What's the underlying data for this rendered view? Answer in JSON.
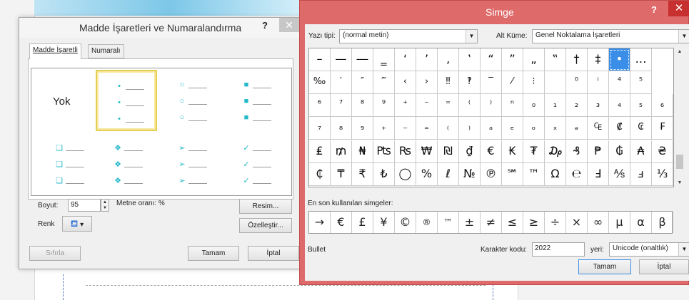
{
  "bullets_dialog": {
    "title": "Madde İşaretleri ve Numaralandırma",
    "help": "?",
    "close": "✕",
    "tabs": [
      "Madde İşaretli",
      "Numaralı"
    ],
    "none_label": "Yok",
    "rows": [
      [
        "•",
        "○",
        "■"
      ],
      [
        "❑",
        "❖",
        "➢",
        "✓"
      ]
    ],
    "size_label": "Boyut:",
    "size_value": "95",
    "ratio_label": "Metne oranı: %",
    "color_label": "Renk",
    "picture_button": "Resim...",
    "customize_button": "Özelleştir...",
    "reset_button": "Sıfırla",
    "ok_button": "Tamam",
    "cancel_button": "İptal",
    "accent_color": "#23b9c8"
  },
  "symbol_dialog": {
    "title": "Simge",
    "help": "?",
    "close": "✕",
    "font_label": "Yazı tipi:",
    "font_value": "(normal metin)",
    "subset_label": "Alt Küme:",
    "subset_value": "Genel Noktalama İşaretleri",
    "symbol_rows": [
      [
        "–",
        "—",
        "―",
        "‗",
        "‘",
        "’",
        "‚",
        "‛",
        "“",
        "”",
        "„",
        "‟",
        "†",
        "‡",
        "•",
        "…"
      ],
      [
        "‰",
        "′",
        "″",
        "‴",
        "‹",
        "›",
        "‼",
        "‽",
        "‾",
        "⁄",
        "⁝",
        " ",
        "⁰",
        "ⁱ",
        "⁴",
        "⁵"
      ],
      [
        "⁶",
        "⁷",
        "⁸",
        "⁹",
        "⁺",
        "⁻",
        "⁼",
        "⁽",
        "⁾",
        "ⁿ",
        "₀",
        "₁",
        "₂",
        "₃",
        "₄",
        "₅",
        "₆"
      ],
      [
        "₇",
        "₈",
        "₉",
        "₊",
        "₋",
        "₌",
        "₍",
        "₎",
        "ₐ",
        "ₑ",
        "ₒ",
        "ₓ",
        "ₔ",
        "₠",
        "₡",
        "₢",
        "₣"
      ],
      [
        "₤",
        "₥",
        "₦",
        "₧",
        "₨",
        "₩",
        "₪",
        "₫",
        "€",
        "₭",
        "₮",
        "₯",
        "₰",
        "₱",
        "₲",
        "₳",
        "₴"
      ],
      [
        "₵",
        "₸",
        "₹",
        "₺",
        "◯",
        "%",
        "ℓ",
        "№",
        "℗",
        "℠",
        "™",
        "Ω",
        "℮",
        "Ⅎ",
        "⅍",
        "ⅎ",
        "⅓"
      ]
    ],
    "selected_symbol": "•",
    "recent_label": "En son kullanılan simgeler:",
    "recent_symbols": [
      "→",
      "€",
      "£",
      "¥",
      "©",
      "®",
      "™",
      "±",
      "≠",
      "≤",
      "≥",
      "÷",
      "×",
      "∞",
      "µ",
      "α",
      "β"
    ],
    "char_name": "Bullet",
    "code_label": "Karakter kodu:",
    "code_value": "2022",
    "from_label": "yeri:",
    "from_value": "Unicode (onaltlık)",
    "ok_button": "Tamam",
    "cancel_button": "İptal",
    "title_color": "#df6a6a",
    "selection_color": "#3b8ee8"
  }
}
